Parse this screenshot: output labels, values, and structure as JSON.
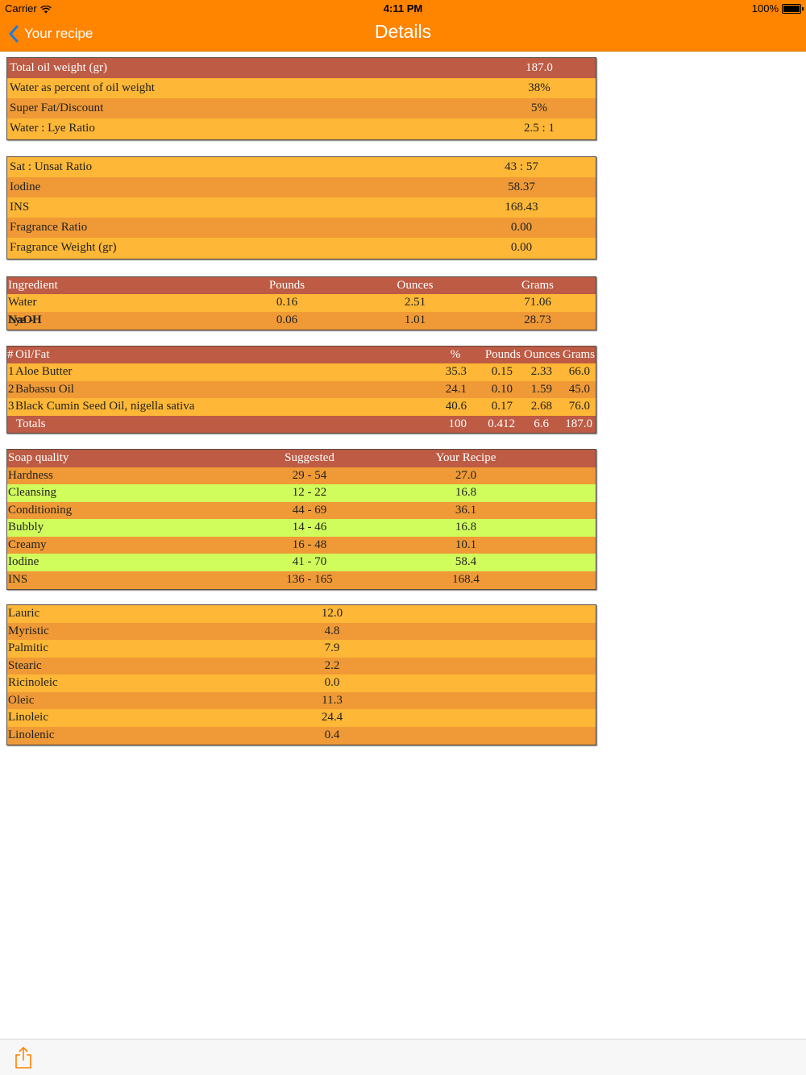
{
  "status": {
    "carrier": "Carrier",
    "time": "4:11 PM",
    "battery": "100%"
  },
  "nav": {
    "back_label": "Your recipe",
    "title": "Details"
  },
  "summary": [
    {
      "label": "Total oil weight (gr)",
      "value": "187.0"
    },
    {
      "label": "Water as percent of oil weight",
      "value": "38%"
    },
    {
      "label": "Super Fat/Discount",
      "value": "5%"
    },
    {
      "label": "Water : Lye Ratio",
      "value": "2.5 : 1"
    }
  ],
  "ratios": [
    {
      "label": "Sat : Unsat Ratio",
      "value": "43 : 57"
    },
    {
      "label": "Iodine",
      "value": "58.37"
    },
    {
      "label": "INS",
      "value": "168.43"
    },
    {
      "label": "Fragrance Ratio",
      "value": "0.00"
    },
    {
      "label": "Fragrance Weight (gr)",
      "value": "0.00"
    }
  ],
  "ingredients": {
    "headers": [
      "Ingredient",
      "Pounds",
      "Ounces",
      "Grams"
    ],
    "rows": [
      {
        "name": "Water",
        "name_bold": "",
        "pounds": "0.16",
        "ounces": "2.51",
        "grams": "71.06"
      },
      {
        "name": "Lye - ",
        "name_bold": "NaOH",
        "pounds": "0.06",
        "ounces": "1.01",
        "grams": "28.73"
      }
    ]
  },
  "oils": {
    "headers": [
      "#",
      "Oil/Fat",
      "%",
      "Pounds",
      "Ounces",
      "Grams"
    ],
    "rows": [
      {
        "num": "1",
        "name": "Aloe Butter",
        "pct": "35.3",
        "pounds": "0.15",
        "ounces": "2.33",
        "grams": "66.0"
      },
      {
        "num": "2",
        "name": "Babassu Oil",
        "pct": "24.1",
        "pounds": "0.10",
        "ounces": "1.59",
        "grams": "45.0"
      },
      {
        "num": "3",
        "name": "Black Cumin Seed Oil, nigella sativa",
        "pct": "40.6",
        "pounds": "0.17",
        "ounces": "2.68",
        "grams": "76.0"
      }
    ],
    "totals": {
      "label": "Totals",
      "pct": "100",
      "pounds": "0.412",
      "ounces": "6.6",
      "grams": "187.0"
    }
  },
  "qualities": {
    "headers": [
      "Soap quality",
      "Suggested",
      "Your Recipe"
    ],
    "rows": [
      {
        "name": "Hardness",
        "suggested": "29 - 54",
        "value": "27.0",
        "in_range": false
      },
      {
        "name": "Cleansing",
        "suggested": "12 - 22",
        "value": "16.8",
        "in_range": true
      },
      {
        "name": "Conditioning",
        "suggested": "44 - 69",
        "value": "36.1",
        "in_range": false
      },
      {
        "name": "Bubbly",
        "suggested": "14 - 46",
        "value": "16.8",
        "in_range": true
      },
      {
        "name": "Creamy",
        "suggested": "16 - 48",
        "value": "10.1",
        "in_range": false
      },
      {
        "name": "Iodine",
        "suggested": "41 - 70",
        "value": "58.4",
        "in_range": true
      },
      {
        "name": "INS",
        "suggested": "136 - 165",
        "value": "168.4",
        "in_range": false
      }
    ]
  },
  "fatty_acids": [
    {
      "name": "Lauric",
      "value": "12.0"
    },
    {
      "name": "Myristic",
      "value": "4.8"
    },
    {
      "name": "Palmitic",
      "value": "7.9"
    },
    {
      "name": "Stearic",
      "value": "2.2"
    },
    {
      "name": "Ricinoleic",
      "value": "0.0"
    },
    {
      "name": "Oleic",
      "value": "11.3"
    },
    {
      "name": "Linoleic",
      "value": "24.4"
    },
    {
      "name": "Linolenic",
      "value": "0.4"
    }
  ],
  "colors": {
    "bar": "#ff8400",
    "header": "#bd5b44",
    "yellow": "#feb736",
    "orange": "#ef9a36",
    "green": "#d1fd5c",
    "back_chevron": "#1f7ae0"
  },
  "icons": {
    "back": "chevron-left-icon",
    "share": "share-icon",
    "wifi": "wifi-icon",
    "battery": "battery-icon"
  }
}
